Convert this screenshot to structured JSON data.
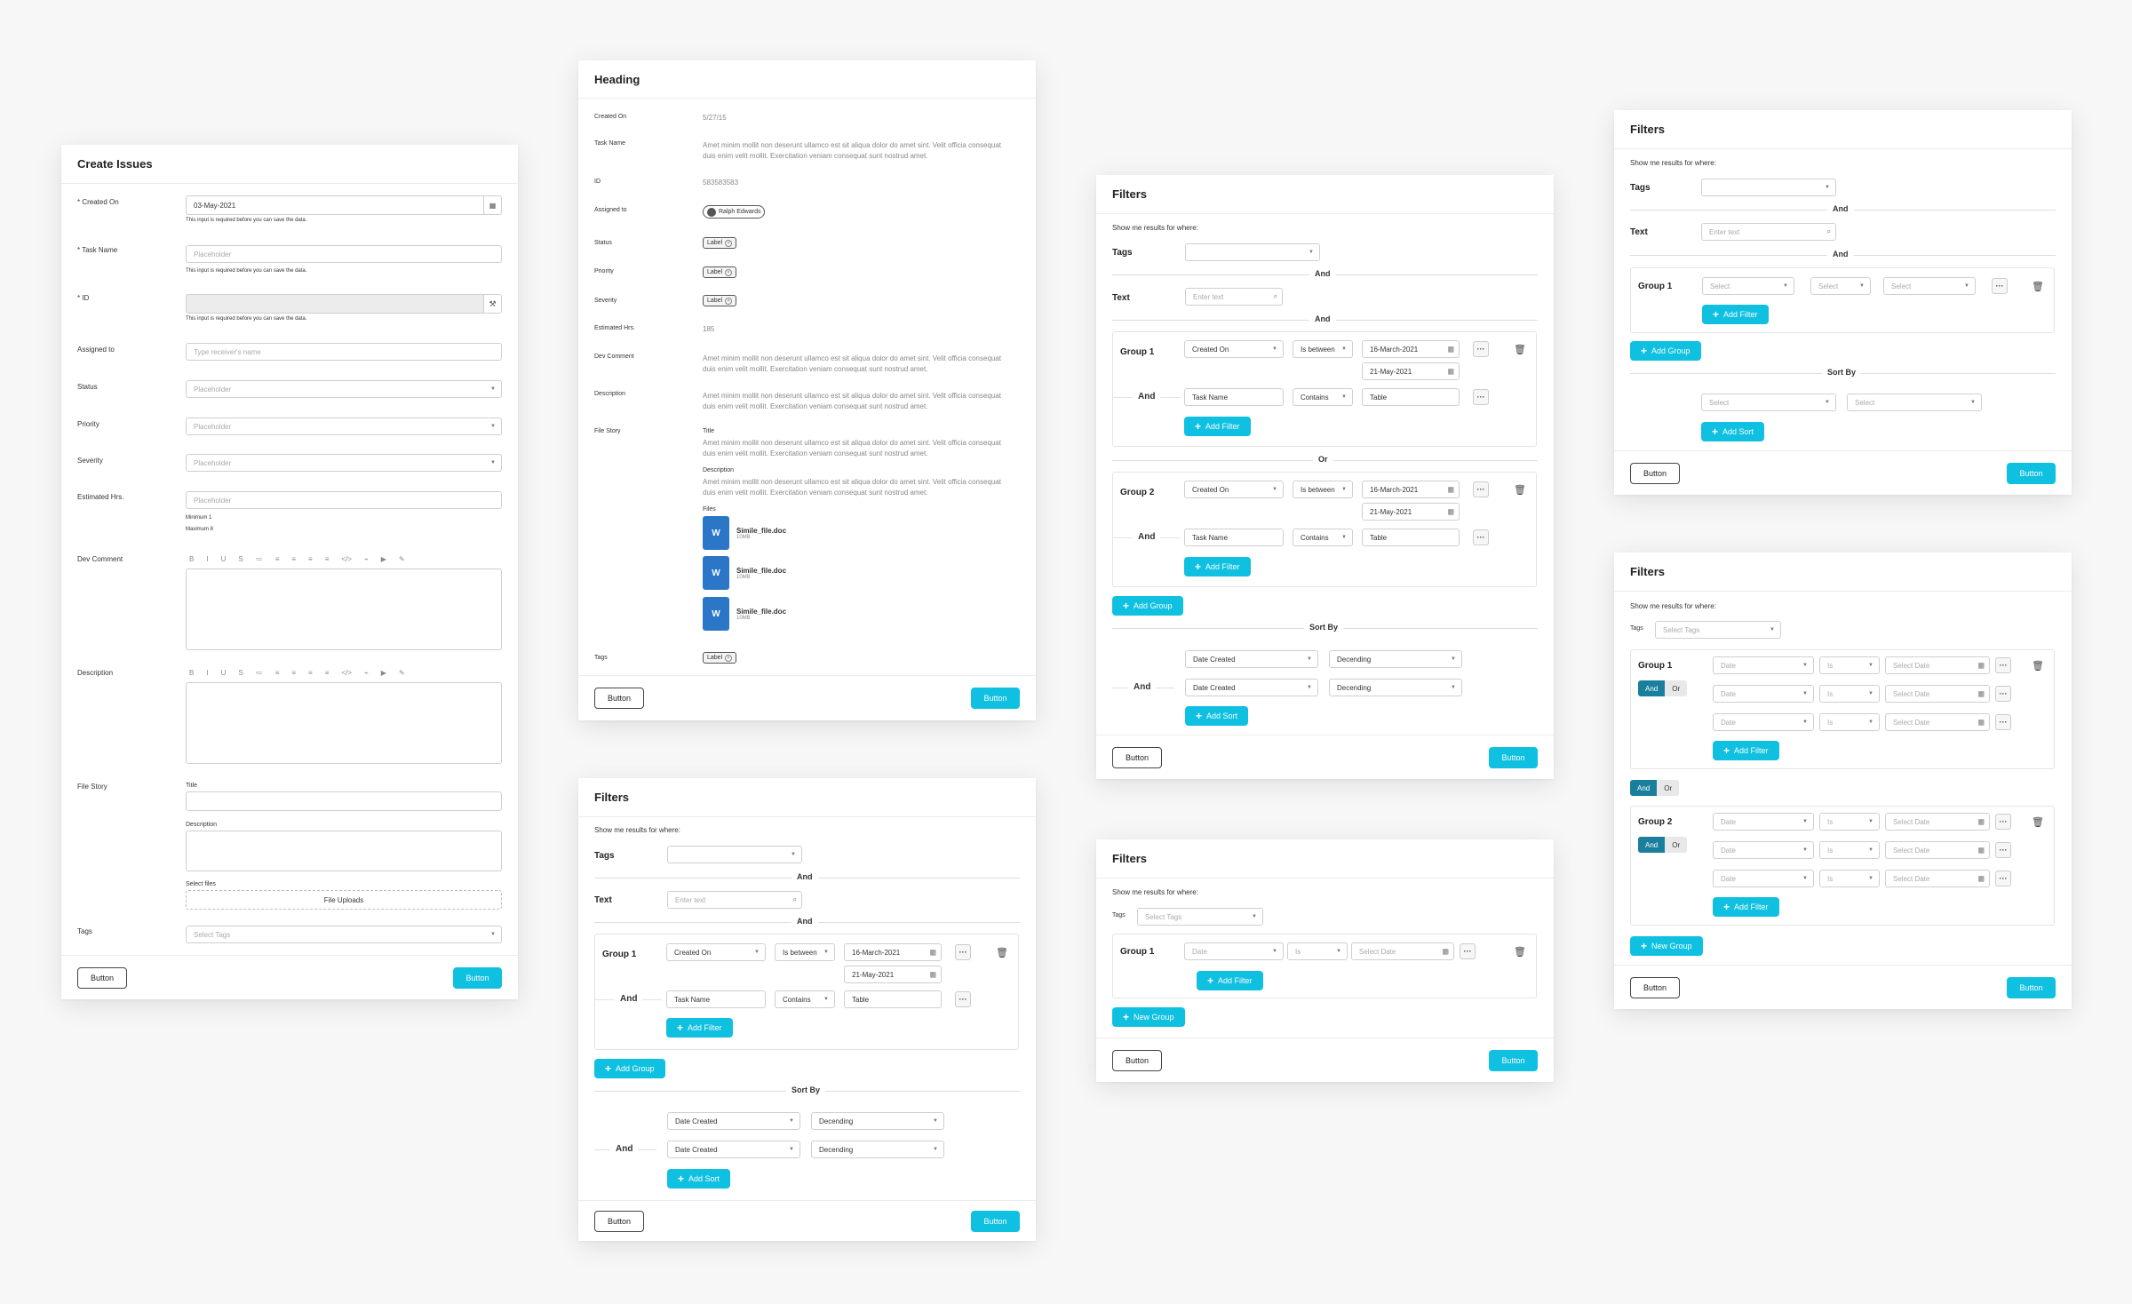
{
  "common": {
    "button_outline": "Button",
    "button_primary": "Button",
    "add_filter": "Add Filter",
    "add_group": "Add Group",
    "add_sort": "Add Sort",
    "new_group": "New Group",
    "plus": "+",
    "dots": "···"
  },
  "create": {
    "title": "Create Issues",
    "created_on": {
      "label": "* Created On",
      "value": "03-May-2021",
      "hint": "This input is required before you can save the data."
    },
    "task_name": {
      "label": "* Task Name",
      "placeholder": "Placeholder",
      "hint": "This input is required before you can save the data."
    },
    "id": {
      "label": "* ID",
      "hint": "This input is required before you can save the data."
    },
    "assigned": {
      "label": "Assigned to",
      "placeholder": "Type receiver's name"
    },
    "status": {
      "label": "Status",
      "placeholder": "Placeholder"
    },
    "priority": {
      "label": "Priority",
      "placeholder": "Placeholder"
    },
    "severity": {
      "label": "Severity",
      "placeholder": "Placeholder"
    },
    "est": {
      "label": "Estimated Hrs.",
      "placeholder": "Placeholder",
      "min": "Minimum 1",
      "max": "Maximum 8"
    },
    "dev_comment": {
      "label": "Dev Comment"
    },
    "description": {
      "label": "Description"
    },
    "toolbar": [
      "B",
      "I",
      "U",
      "S",
      "≔",
      "≡",
      "≡",
      "≡",
      "≡",
      "</>",
      "⌁",
      "▶",
      "✎"
    ],
    "file_story": {
      "label": "File Story",
      "title": "Title",
      "description": "Description",
      "select_files": "Select files",
      "upload": "File Uploads"
    },
    "tags": {
      "label": "Tags",
      "placeholder": "Select Tags"
    }
  },
  "detail": {
    "title": "Heading",
    "lorem": "Amet minim mollit non deserunt ullamco est sit aliqua dolor do amet sint. Velit officia consequat duis enim velit mollit. Exercitation veniam consequat sunt nostrud amet.",
    "rows": {
      "created_on": {
        "label": "Created On",
        "value": "5/27/15"
      },
      "task_name": {
        "label": "Task Name"
      },
      "id": {
        "label": "ID",
        "value": "583583583"
      },
      "assigned": {
        "label": "Assigned to",
        "value": "Ralph Edwards"
      },
      "status": {
        "label": "Status",
        "value": "Label"
      },
      "priority": {
        "label": "Priority",
        "value": "Label"
      },
      "severity": {
        "label": "Severity",
        "value": "Label"
      },
      "est": {
        "label": "Estimated Hrs.",
        "value": "185"
      },
      "dev_comment": {
        "label": "Dev Comment"
      },
      "description": {
        "label": "Description"
      },
      "file_story": {
        "label": "File Story",
        "title": "Title",
        "description": "Description",
        "files": "Files"
      },
      "tags": {
        "label": "Tags",
        "value": "Label"
      }
    },
    "files": [
      {
        "name": "Simile_file.doc",
        "size": "10MB"
      },
      {
        "name": "Simile_file.doc",
        "size": "10MB"
      },
      {
        "name": "Simile_file.doc",
        "size": "10MB"
      }
    ]
  },
  "filters": {
    "title": "Filters",
    "show": "Show me results for where:",
    "tags": "Tags",
    "text": "Text",
    "and": "And",
    "or": "Or",
    "enter_text": "Enter text",
    "group1": "Group 1",
    "group2": "Group 2",
    "sort_by": "Sort By",
    "created_on": "Created On",
    "is_between": "Is between",
    "date1": "16-March-2021",
    "date2": "21-May-2021",
    "task_name": "Task Name",
    "contains": "Contains",
    "table": "Table",
    "date_created": "Date Created",
    "decending": "Decending",
    "select": "Select",
    "select_tags": "Select Tags",
    "date": "Date",
    "is": "Is",
    "select_date": "Select Date"
  }
}
